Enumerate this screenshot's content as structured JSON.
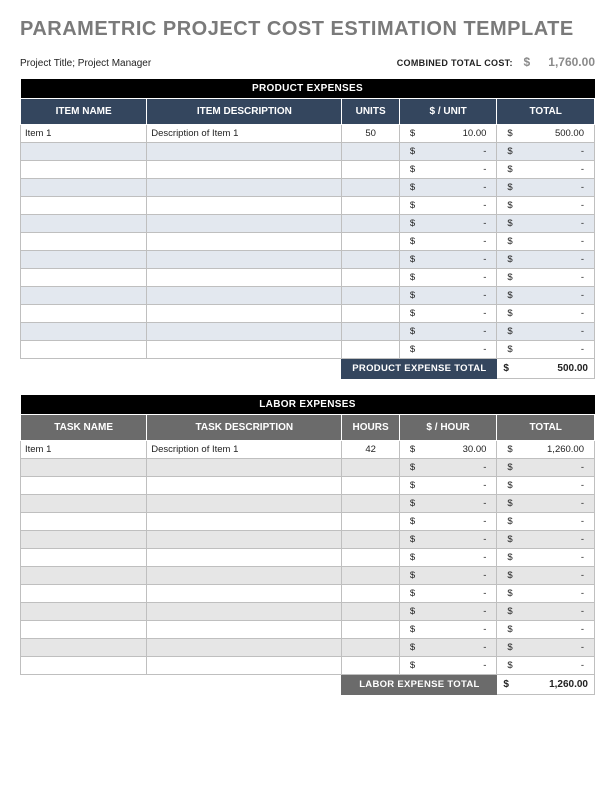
{
  "title": "PARAMETRIC PROJECT COST ESTIMATION TEMPLATE",
  "subtitle": "Project Title; Project Manager",
  "combined": {
    "label": "COMBINED TOTAL COST:",
    "currency": "$",
    "value": "1,760.00"
  },
  "product": {
    "section_title": "PRODUCT EXPENSES",
    "headers": {
      "name": "ITEM NAME",
      "desc": "ITEM DESCRIPTION",
      "units": "UNITS",
      "rate": "$ / UNIT",
      "total": "TOTAL"
    },
    "rows": [
      {
        "name": "Item 1",
        "desc": "Description of Item 1",
        "units": "50",
        "rate": "10.00",
        "total": "500.00"
      },
      {
        "name": "",
        "desc": "",
        "units": "",
        "rate": "-",
        "total": "-"
      },
      {
        "name": "",
        "desc": "",
        "units": "",
        "rate": "-",
        "total": "-"
      },
      {
        "name": "",
        "desc": "",
        "units": "",
        "rate": "-",
        "total": "-"
      },
      {
        "name": "",
        "desc": "",
        "units": "",
        "rate": "-",
        "total": "-"
      },
      {
        "name": "",
        "desc": "",
        "units": "",
        "rate": "-",
        "total": "-"
      },
      {
        "name": "",
        "desc": "",
        "units": "",
        "rate": "-",
        "total": "-"
      },
      {
        "name": "",
        "desc": "",
        "units": "",
        "rate": "-",
        "total": "-"
      },
      {
        "name": "",
        "desc": "",
        "units": "",
        "rate": "-",
        "total": "-"
      },
      {
        "name": "",
        "desc": "",
        "units": "",
        "rate": "-",
        "total": "-"
      },
      {
        "name": "",
        "desc": "",
        "units": "",
        "rate": "-",
        "total": "-"
      },
      {
        "name": "",
        "desc": "",
        "units": "",
        "rate": "-",
        "total": "-"
      },
      {
        "name": "",
        "desc": "",
        "units": "",
        "rate": "-",
        "total": "-"
      }
    ],
    "footer": {
      "label": "PRODUCT EXPENSE TOTAL",
      "currency": "$",
      "value": "500.00"
    }
  },
  "labor": {
    "section_title": "LABOR EXPENSES",
    "headers": {
      "name": "TASK NAME",
      "desc": "TASK DESCRIPTION",
      "units": "HOURS",
      "rate": "$ / HOUR",
      "total": "TOTAL"
    },
    "rows": [
      {
        "name": "Item 1",
        "desc": "Description of Item 1",
        "units": "42",
        "rate": "30.00",
        "total": "1,260.00"
      },
      {
        "name": "",
        "desc": "",
        "units": "",
        "rate": "-",
        "total": "-"
      },
      {
        "name": "",
        "desc": "",
        "units": "",
        "rate": "-",
        "total": "-"
      },
      {
        "name": "",
        "desc": "",
        "units": "",
        "rate": "-",
        "total": "-"
      },
      {
        "name": "",
        "desc": "",
        "units": "",
        "rate": "-",
        "total": "-"
      },
      {
        "name": "",
        "desc": "",
        "units": "",
        "rate": "-",
        "total": "-"
      },
      {
        "name": "",
        "desc": "",
        "units": "",
        "rate": "-",
        "total": "-"
      },
      {
        "name": "",
        "desc": "",
        "units": "",
        "rate": "-",
        "total": "-"
      },
      {
        "name": "",
        "desc": "",
        "units": "",
        "rate": "-",
        "total": "-"
      },
      {
        "name": "",
        "desc": "",
        "units": "",
        "rate": "-",
        "total": "-"
      },
      {
        "name": "",
        "desc": "",
        "units": "",
        "rate": "-",
        "total": "-"
      },
      {
        "name": "",
        "desc": "",
        "units": "",
        "rate": "-",
        "total": "-"
      },
      {
        "name": "",
        "desc": "",
        "units": "",
        "rate": "-",
        "total": "-"
      }
    ],
    "footer": {
      "label": "LABOR EXPENSE TOTAL",
      "currency": "$",
      "value": "1,260.00"
    }
  },
  "currency": "$"
}
